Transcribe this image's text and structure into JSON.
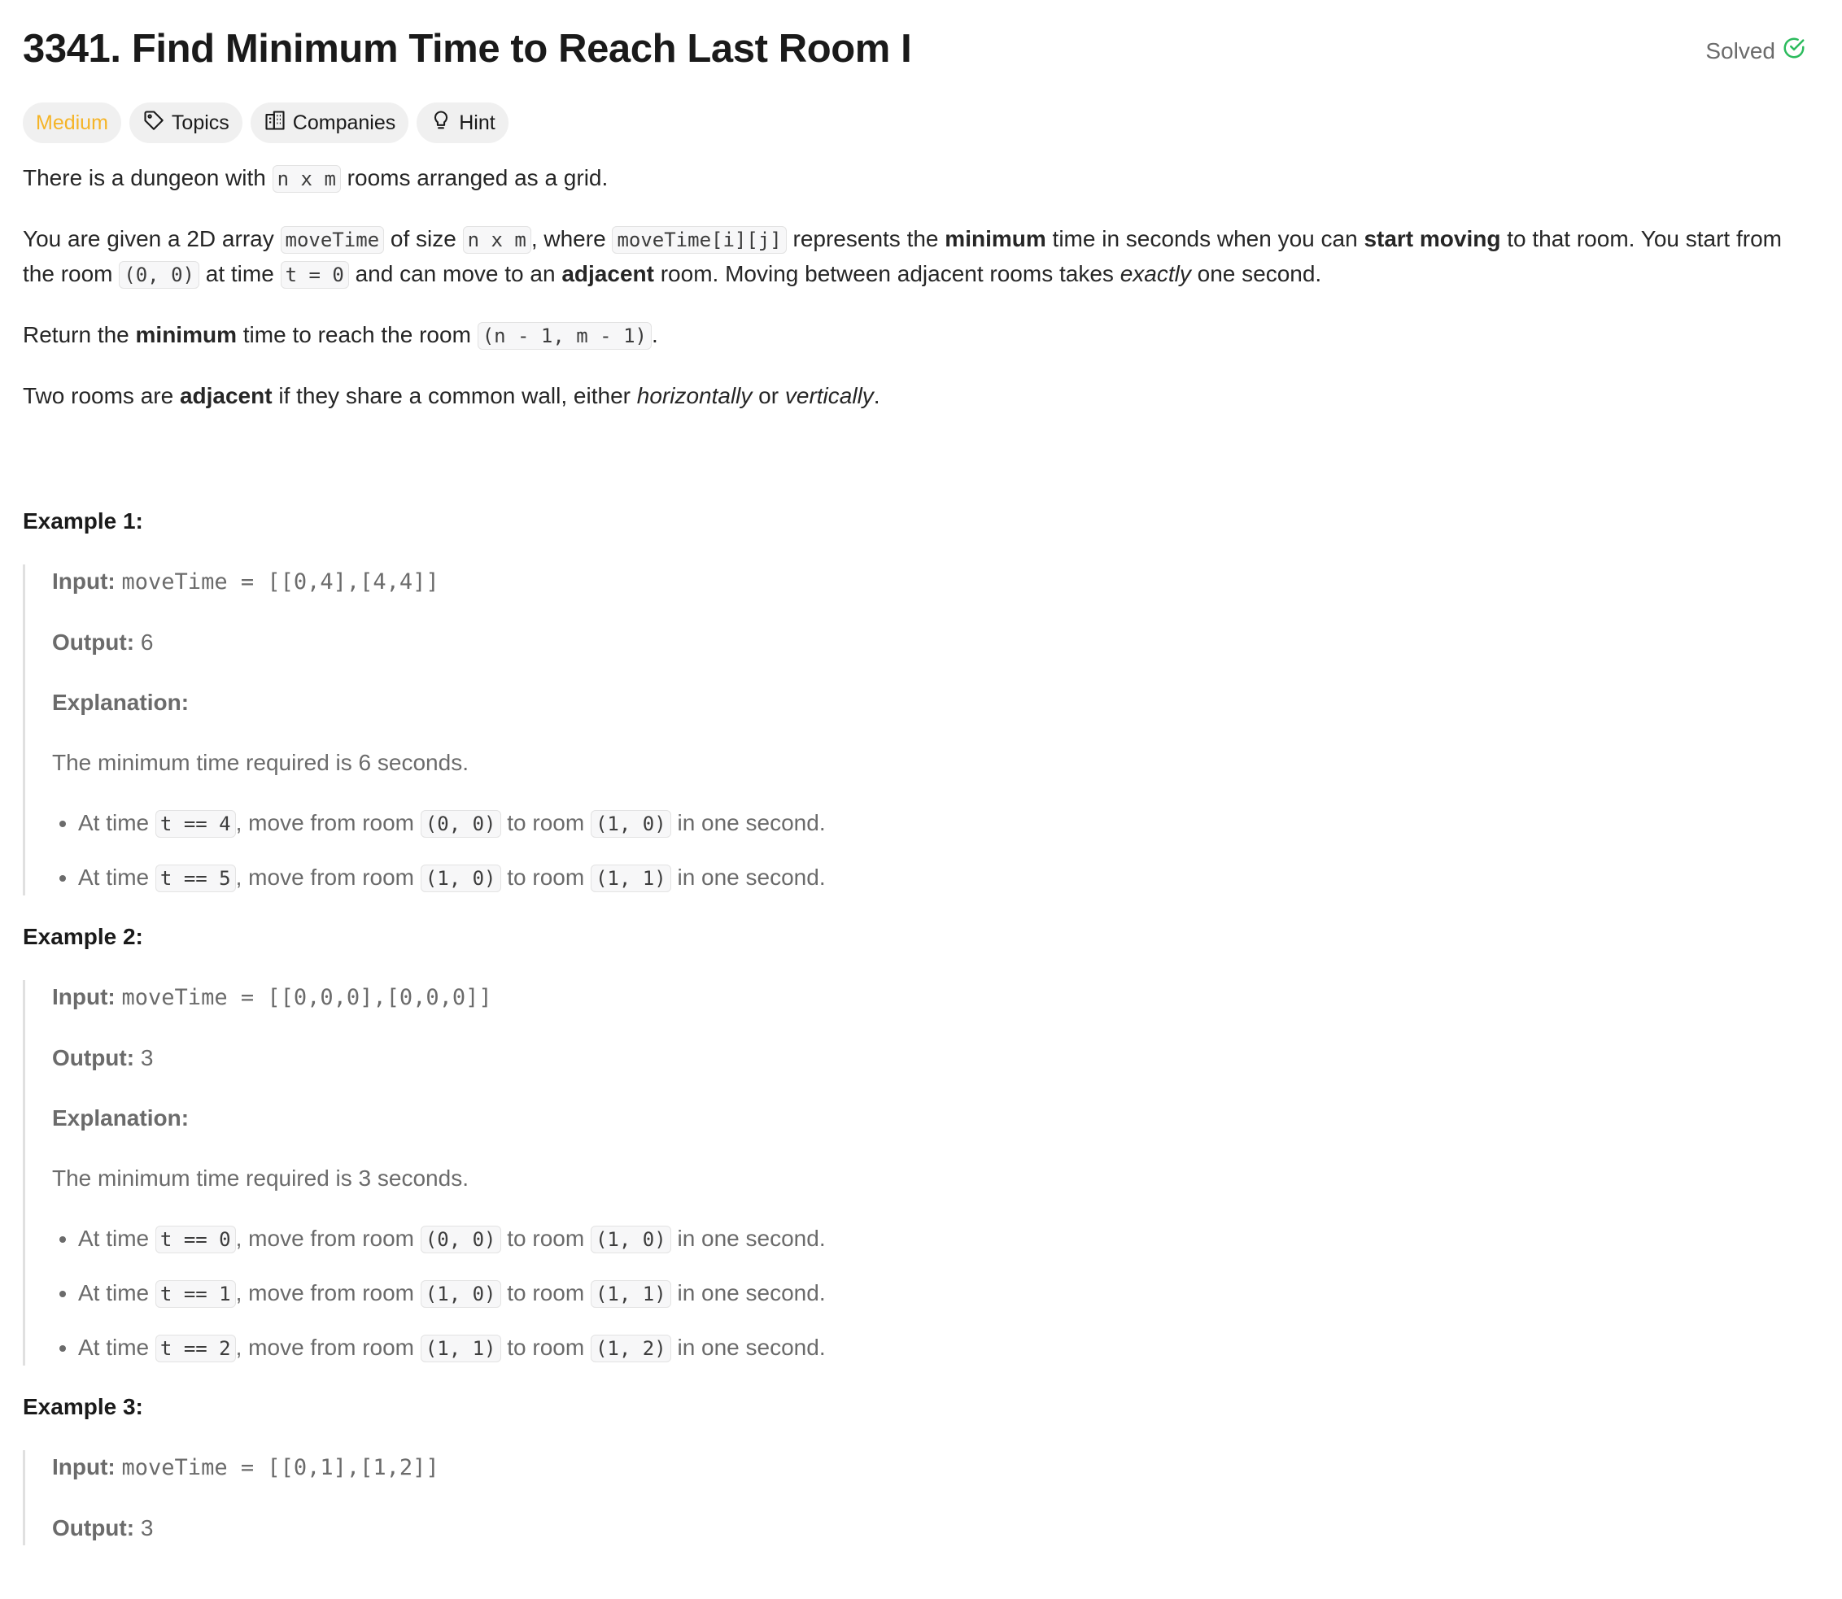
{
  "problem": {
    "number": "3341.",
    "title": "Find Minimum Time to Reach Last Room I",
    "status": "Solved",
    "difficulty": "Medium",
    "tags": {
      "topics": "Topics",
      "companies": "Companies",
      "hint": "Hint"
    }
  },
  "description": {
    "p1": {
      "a": "There is a dungeon with ",
      "code1": "n x m",
      "b": " rooms arranged as a grid."
    },
    "p2": {
      "a": "You are given a 2D array ",
      "code1": "moveTime",
      "b": " of size ",
      "code2": "n x m",
      "c": ", where ",
      "code3": "moveTime[i][j]",
      "d": " represents the ",
      "bold1": "minimum",
      "e": " time in seconds when you can ",
      "bold2": "start moving",
      "f": " to that room. You start from the room ",
      "code4": "(0, 0)",
      "g": " at time ",
      "code5": "t = 0",
      "h": " and can move to an ",
      "bold3": "adjacent",
      "i": " room. Moving between adjacent rooms takes ",
      "italic1": "exactly",
      "j": " one second."
    },
    "p3": {
      "a": "Return the ",
      "bold1": "minimum",
      "b": " time to reach the room ",
      "code1": "(n - 1, m - 1)",
      "c": "."
    },
    "p4": {
      "a": "Two rooms are ",
      "bold1": "adjacent",
      "b": " if they share a common wall, either ",
      "italic1": "horizontally",
      "c": " or ",
      "italic2": "vertically",
      "d": "."
    }
  },
  "labels": {
    "input": "Input:",
    "output": "Output:",
    "explanation": "Explanation:"
  },
  "examples": [
    {
      "title": "Example 1:",
      "input": "moveTime = [[0,4],[4,4]]",
      "output": "6",
      "summary": "The minimum time required is 6 seconds.",
      "steps": [
        {
          "a": "At time ",
          "t": "t == 4",
          "b": ", move from room ",
          "from": "(0, 0)",
          "c": " to room ",
          "to": "(1, 0)",
          "d": " in one second."
        },
        {
          "a": "At time ",
          "t": "t == 5",
          "b": ", move from room ",
          "from": "(1, 0)",
          "c": " to room ",
          "to": "(1, 1)",
          "d": " in one second."
        }
      ]
    },
    {
      "title": "Example 2:",
      "input": "moveTime = [[0,0,0],[0,0,0]]",
      "output": "3",
      "summary": "The minimum time required is 3 seconds.",
      "steps": [
        {
          "a": "At time ",
          "t": "t == 0",
          "b": ", move from room ",
          "from": "(0, 0)",
          "c": " to room ",
          "to": "(1, 0)",
          "d": " in one second."
        },
        {
          "a": "At time ",
          "t": "t == 1",
          "b": ", move from room ",
          "from": "(1, 0)",
          "c": " to room ",
          "to": "(1, 1)",
          "d": " in one second."
        },
        {
          "a": "At time ",
          "t": "t == 2",
          "b": ", move from room ",
          "from": "(1, 1)",
          "c": " to room ",
          "to": "(1, 2)",
          "d": " in one second."
        }
      ]
    },
    {
      "title": "Example 3:",
      "input": "moveTime = [[0,1],[1,2]]",
      "output": "3"
    }
  ],
  "colors": {
    "medium": "#f5b427",
    "solved_check": "#2cbb5d",
    "text": "#262626",
    "muted": "#6b6b6b"
  },
  "icons": {
    "solved": "check-circle-icon",
    "topics": "tag-icon",
    "companies": "building-icon",
    "hint": "lightbulb-icon"
  }
}
